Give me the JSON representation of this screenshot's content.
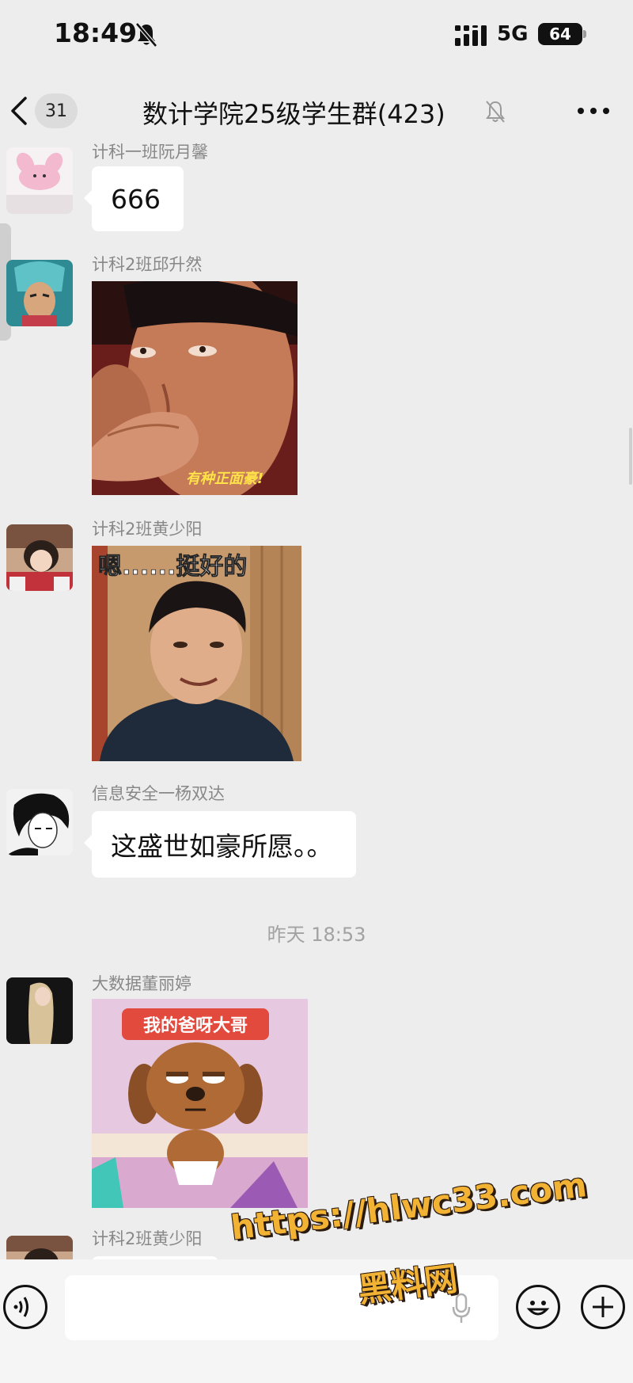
{
  "status_bar": {
    "time": "18:49",
    "network": "5G",
    "battery": "64"
  },
  "nav": {
    "unread_count": "31",
    "title": "数计学院25级学生群(423)"
  },
  "messages": [
    {
      "sender": "计科一班阮月馨",
      "type": "text",
      "text": "666"
    },
    {
      "sender": "计科2班邱升然",
      "type": "sticker",
      "caption": "有种正面豪!"
    },
    {
      "sender": "计科2班黄少阳",
      "type": "sticker",
      "caption": "嗯......挺好的"
    },
    {
      "sender": "信息安全一杨双达",
      "type": "text",
      "text": "这盛世如豪所愿。。"
    },
    {
      "sender": "大数据董丽婷",
      "type": "sticker",
      "caption": "我的爸呀大哥"
    },
    {
      "sender": "计科2班黄少阳",
      "type": "text",
      "text": ""
    }
  ],
  "timestamp": "昨天 18:53",
  "input": {
    "placeholder": ""
  },
  "watermark": {
    "url": "https://hlwc33.com",
    "name": "黑料网"
  },
  "colors": {
    "background": "#ededed",
    "bubble": "#ffffff",
    "sender_text": "#888888",
    "watermark": "#f2b233"
  },
  "icons": [
    "bell-slash-icon",
    "signal-icon",
    "battery-icon",
    "back-chevron-icon",
    "mute-icon",
    "more-icon",
    "voice-icon",
    "mic-icon",
    "emoji-icon",
    "plus-icon"
  ]
}
